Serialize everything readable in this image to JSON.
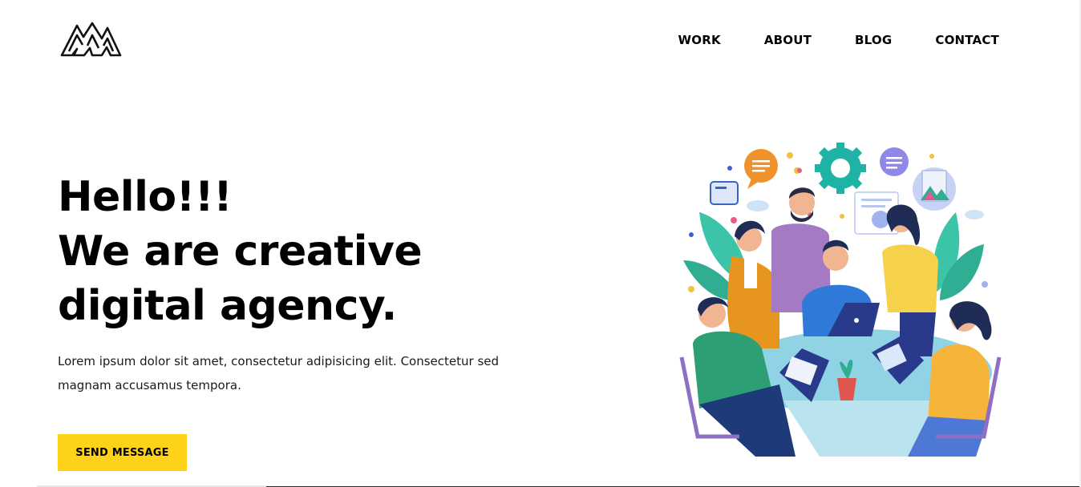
{
  "logo": {
    "icon": "mountain-m-logo"
  },
  "nav": {
    "items": [
      {
        "label": "WORK"
      },
      {
        "label": "ABOUT"
      },
      {
        "label": "BLOG"
      },
      {
        "label": "CONTACT"
      }
    ]
  },
  "hero": {
    "title_line1": "Hello!!!",
    "title_line2": "We are creative",
    "title_line3": "digital agency.",
    "description": "Lorem ipsum dolor sit amet, consectetur adipisicing elit. Consectetur sed magnam accusamus tempora.",
    "cta_label": "SEND MESSAGE"
  },
  "colors": {
    "accent": "#ffd21a",
    "text": "#000000",
    "background": "#ffffff"
  },
  "illustration": {
    "icon": "team-meeting-illustration"
  }
}
